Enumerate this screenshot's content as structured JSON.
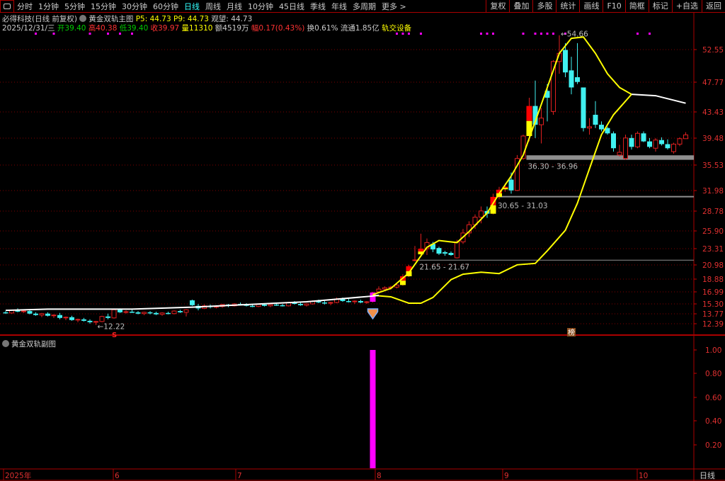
{
  "toolbar": {
    "left_icon": "panel-toggle-icon",
    "items": [
      "分时",
      "1分钟",
      "5分钟",
      "15分钟",
      "30分钟",
      "60分钟",
      "日线",
      "周线",
      "月线",
      "10分钟",
      "45日线",
      "季线",
      "年线",
      "多周期",
      "更多 >"
    ],
    "active": "日线",
    "right_items": [
      "复权",
      "叠加",
      "多股",
      "统计",
      "画线",
      "F10",
      "简框",
      "标记",
      "+自选",
      "返回"
    ]
  },
  "info_line1": {
    "stock": "必得科技(日线 前复权)",
    "indicator": "黄金双轨主图",
    "p5": "P5: 44.73",
    "p9": "P9: 44.73",
    "watch": "观望: 44.73"
  },
  "info_line2": {
    "date": "2025/12/31/三",
    "open": "开39.40",
    "high": "高40.38",
    "low": "低39.40",
    "close": "收39.97",
    "volume": "量11310",
    "amount": "额4519万",
    "change": "幅0.17(0.43%)",
    "turnover": "换0.61%",
    "float": "流通1.85亿",
    "concept": "轨交设备"
  },
  "sub_title": "黄金双轨副图",
  "colors": {
    "up": "#e02020",
    "down": "#40f0f0",
    "ma_yellow": "#ffff00",
    "ma_white": "#ffffff",
    "signal": "#ff00ff",
    "grid": "#800000"
  },
  "chart_data": [
    {
      "type": "candlestick",
      "y_scale": "custom-ticks",
      "y_ticks": [
        "52.55",
        "47.77",
        "43.43",
        "39.48",
        "35.53",
        "31.98",
        "28.78",
        "25.90",
        "23.31",
        "20.98",
        "18.88",
        "16.99",
        "15.30",
        "13.77",
        "12.39"
      ],
      "x_ticks": [
        "2025年",
        "6",
        "7",
        "8",
        "9",
        "10"
      ],
      "period_label": "日线",
      "candles": [
        [
          14.0,
          14.2,
          13.8,
          13.9
        ],
        [
          13.9,
          14.4,
          13.8,
          14.3
        ],
        [
          14.3,
          14.6,
          14.0,
          14.1
        ],
        [
          14.1,
          14.3,
          13.9,
          14.2
        ],
        [
          14.2,
          14.5,
          13.7,
          13.8
        ],
        [
          13.8,
          14.0,
          13.5,
          13.6
        ],
        [
          13.6,
          13.9,
          13.3,
          13.8
        ],
        [
          13.8,
          14.0,
          13.4,
          13.5
        ],
        [
          13.5,
          13.7,
          13.2,
          13.6
        ],
        [
          13.6,
          13.9,
          13.0,
          13.2
        ],
        [
          13.2,
          13.4,
          12.9,
          13.3
        ],
        [
          13.3,
          13.5,
          12.8,
          12.9
        ],
        [
          12.9,
          13.1,
          12.6,
          13.0
        ],
        [
          13.0,
          13.2,
          12.7,
          12.8
        ],
        [
          12.8,
          13.0,
          12.4,
          12.6
        ],
        [
          12.6,
          12.8,
          12.22,
          12.7
        ],
        [
          12.7,
          13.5,
          12.6,
          13.4
        ],
        [
          13.4,
          13.8,
          13.0,
          13.2
        ],
        [
          13.2,
          14.6,
          13.1,
          14.4
        ],
        [
          14.4,
          14.6,
          13.9,
          14.0
        ],
        [
          14.0,
          14.3,
          13.8,
          14.1
        ],
        [
          14.1,
          14.4,
          13.9,
          14.0
        ],
        [
          14.0,
          14.2,
          13.7,
          13.8
        ],
        [
          13.8,
          14.1,
          13.6,
          14.0
        ],
        [
          14.0,
          14.2,
          13.7,
          13.9
        ],
        [
          13.9,
          14.1,
          13.6,
          13.7
        ],
        [
          13.7,
          14.0,
          13.5,
          13.9
        ],
        [
          13.9,
          14.1,
          13.7,
          13.8
        ],
        [
          13.8,
          14.3,
          13.7,
          14.2
        ],
        [
          14.2,
          14.4,
          13.9,
          14.0
        ],
        [
          14.0,
          14.5,
          13.4,
          14.4
        ],
        [
          15.8,
          15.9,
          15.0,
          15.1
        ],
        [
          15.0,
          15.3,
          14.3,
          14.6
        ],
        [
          14.6,
          15.2,
          14.5,
          15.0
        ],
        [
          15.0,
          15.2,
          14.6,
          14.8
        ],
        [
          14.8,
          15.1,
          14.6,
          14.9
        ],
        [
          14.9,
          15.3,
          14.7,
          15.2
        ],
        [
          15.2,
          15.3,
          14.8,
          15.0
        ],
        [
          15.0,
          15.4,
          14.9,
          15.3
        ],
        [
          15.3,
          15.5,
          15.1,
          15.2
        ],
        [
          15.2,
          15.4,
          14.9,
          15.0
        ],
        [
          15.0,
          15.2,
          14.8,
          14.9
        ],
        [
          14.9,
          15.3,
          14.8,
          15.2
        ],
        [
          15.2,
          15.3,
          14.9,
          15.0
        ],
        [
          15.0,
          15.3,
          14.8,
          15.2
        ],
        [
          15.2,
          15.4,
          15.0,
          15.1
        ],
        [
          15.1,
          15.3,
          14.9,
          15.0
        ],
        [
          15.0,
          15.6,
          14.9,
          15.5
        ],
        [
          15.5,
          15.7,
          15.2,
          15.3
        ],
        [
          15.3,
          15.5,
          15.0,
          15.1
        ],
        [
          15.1,
          15.4,
          14.9,
          15.3
        ],
        [
          15.3,
          15.8,
          15.2,
          15.7
        ],
        [
          15.7,
          15.9,
          15.4,
          15.5
        ],
        [
          15.5,
          15.7,
          15.2,
          15.4
        ],
        [
          15.4,
          15.6,
          15.1,
          15.5
        ],
        [
          15.5,
          16.2,
          15.4,
          16.0
        ],
        [
          16.0,
          16.2,
          15.6,
          15.7
        ],
        [
          15.7,
          16.0,
          15.5,
          15.6
        ],
        [
          15.6,
          15.8,
          15.3,
          15.7
        ],
        [
          15.7,
          15.9,
          15.4,
          15.5
        ],
        [
          15.5,
          15.7,
          15.3,
          15.6
        ],
        [
          15.6,
          17.0,
          15.5,
          16.9
        ],
        [
          17.0,
          17.8,
          16.8,
          17.4
        ],
        [
          17.4,
          17.8,
          17.2,
          17.6
        ],
        [
          17.6,
          17.9,
          17.3,
          17.7
        ],
        [
          17.7,
          18.2,
          17.5,
          18.0
        ],
        [
          18.0,
          19.6,
          17.9,
          19.3
        ],
        [
          19.3,
          21.0,
          19.2,
          20.8
        ],
        [
          21.6,
          23.7,
          21.5,
          21.7
        ],
        [
          22.5,
          25.5,
          22.3,
          23.3
        ],
        [
          23.3,
          24.8,
          22.4,
          24.2
        ],
        [
          24.0,
          24.3,
          22.8,
          23.2
        ],
        [
          23.4,
          23.6,
          22.4,
          22.6
        ],
        [
          22.8,
          23.0,
          22.3,
          22.6
        ],
        [
          22.7,
          22.9,
          22.3,
          22.4
        ],
        [
          22.0,
          24.6,
          21.9,
          24.3
        ],
        [
          24.3,
          26.2,
          24.0,
          25.6
        ],
        [
          25.6,
          27.3,
          25.0,
          26.8
        ],
        [
          26.8,
          28.3,
          26.2,
          27.9
        ],
        [
          27.9,
          29.5,
          27.0,
          28.8
        ],
        [
          28.8,
          29.5,
          27.8,
          28.4
        ],
        [
          28.4,
          31.5,
          28.3,
          31.0
        ],
        [
          31.0,
          32.5,
          30.6,
          32.1
        ],
        [
          32.2,
          33.0,
          31.8,
          32.5
        ],
        [
          33.5,
          34.5,
          31.5,
          32.0
        ],
        [
          32.0,
          37.0,
          31.9,
          36.5
        ],
        [
          36.5,
          40.0,
          36.3,
          39.8
        ],
        [
          39.8,
          45.5,
          39.0,
          44.3
        ],
        [
          44.3,
          48.0,
          39.5,
          41.5
        ],
        [
          41.5,
          44.0,
          38.7,
          42.5
        ],
        [
          46.5,
          47.5,
          42.0,
          45.5
        ],
        [
          43.5,
          51.0,
          43.0,
          50.8
        ],
        [
          50.8,
          54.66,
          49.0,
          52.0
        ],
        [
          52.5,
          53.5,
          48.5,
          49.2
        ],
        [
          49.5,
          51.5,
          46.0,
          47.0
        ],
        [
          48.5,
          53.5,
          47.5,
          47.8
        ],
        [
          47.0,
          47.0,
          40.5,
          41.0
        ],
        [
          41.0,
          42.5,
          40.0,
          41.2
        ],
        [
          43.0,
          45.0,
          41.0,
          41.5
        ],
        [
          41.5,
          42.0,
          40.5,
          40.8
        ],
        [
          41.0,
          41.2,
          40.0,
          40.2
        ],
        [
          40.2,
          40.5,
          37.5,
          38.0
        ],
        [
          37.0,
          38.5,
          36.8,
          37.4
        ],
        [
          36.5,
          40.0,
          36.3,
          39.5
        ],
        [
          39.5,
          40.0,
          37.8,
          38.2
        ],
        [
          38.2,
          40.5,
          38.0,
          40.2
        ],
        [
          40.2,
          40.5,
          38.9,
          39.0
        ],
        [
          39.0,
          39.5,
          38.0,
          38.2
        ],
        [
          38.0,
          39.5,
          37.5,
          39.2
        ],
        [
          39.2,
          39.6,
          38.4,
          38.6
        ],
        [
          38.6,
          39.3,
          37.8,
          38.0
        ],
        [
          37.5,
          38.8,
          37.2,
          38.6
        ],
        [
          38.6,
          39.6,
          38.3,
          39.4
        ],
        [
          39.4,
          40.38,
          39.4,
          39.97
        ]
      ],
      "highlight_candles": [
        66,
        67,
        69,
        81,
        82,
        83,
        87
      ],
      "signal_candle": 61,
      "top_dots": [
        5,
        8,
        14,
        17,
        19,
        21,
        65,
        66,
        67,
        69,
        79,
        80,
        81,
        86,
        88,
        89,
        90,
        91,
        93,
        105,
        107
      ],
      "lines": [
        {
          "color": "#ffff00",
          "points": [
            [
              61,
              16.6
            ],
            [
              64,
              17.5
            ],
            [
              67,
              19.8
            ],
            [
              70,
              23.5
            ],
            [
              72,
              24.5
            ],
            [
              75,
              24.2
            ],
            [
              77,
              25.8
            ],
            [
              80,
              28.5
            ],
            [
              82,
              31.5
            ],
            [
              84,
              34
            ],
            [
              86,
              37
            ],
            [
              88,
              42
            ],
            [
              90,
              47
            ],
            [
              92,
              52
            ],
            [
              94,
              54.2
            ],
            [
              96,
              54.4
            ],
            [
              98,
              52
            ],
            [
              100,
              49
            ],
            [
              102,
              47
            ],
            [
              104,
              46
            ]
          ]
        },
        {
          "color": "#ffff00",
          "points": [
            [
              61,
              16.5
            ],
            [
              64,
              16.3
            ],
            [
              67,
              15.4
            ],
            [
              69,
              15.4
            ],
            [
              71,
              16.2
            ],
            [
              74,
              18.8
            ],
            [
              76,
              19.6
            ],
            [
              79,
              19.9
            ],
            [
              82,
              19.7
            ],
            [
              85,
              21
            ],
            [
              88,
              21.2
            ],
            [
              90,
              23
            ],
            [
              93,
              26
            ],
            [
              95,
              30
            ],
            [
              97,
              35
            ],
            [
              99,
              40
            ],
            [
              101,
              43
            ],
            [
              104,
              46
            ]
          ]
        },
        {
          "color": "#ffffff",
          "points": [
            [
              0,
              14.3
            ],
            [
              7,
              14.5
            ],
            [
              21,
              14.5
            ],
            [
              31,
              14.8
            ],
            [
              50,
              15.6
            ],
            [
              61,
              16.4
            ],
            [
              62,
              16.5
            ]
          ]
        },
        {
          "color": "#ffffff",
          "points": [
            [
              104,
              46
            ],
            [
              108,
              45.8
            ],
            [
              113,
              44.7
            ]
          ]
        }
      ],
      "zones": [
        {
          "low": 36.3,
          "high": 36.96,
          "start": 87,
          "label": "36.30 - 36.96",
          "thick": true
        },
        {
          "low": 30.65,
          "high": 31.03,
          "start": 82,
          "label": "30.65 - 31.03",
          "thick": false
        },
        {
          "low": 21.65,
          "high": 21.67,
          "start": 69,
          "label": "21.65 - 21.67",
          "thick": false
        }
      ],
      "annotations": {
        "low_label": "←12.22",
        "low_index": 15,
        "high_label": "←54.66",
        "high_index": 92,
        "s_marker": "S",
        "s_index": 18,
        "rank_badge": "榜",
        "rank_index": 94
      }
    },
    {
      "type": "bar",
      "title": "黄金双轨副图",
      "y_ticks": [
        "1.00",
        "0.80",
        "0.60",
        "0.40",
        "0.20"
      ],
      "ylim": [
        0,
        1
      ],
      "bars": [
        {
          "index": 61,
          "value": 1.0
        }
      ]
    }
  ]
}
